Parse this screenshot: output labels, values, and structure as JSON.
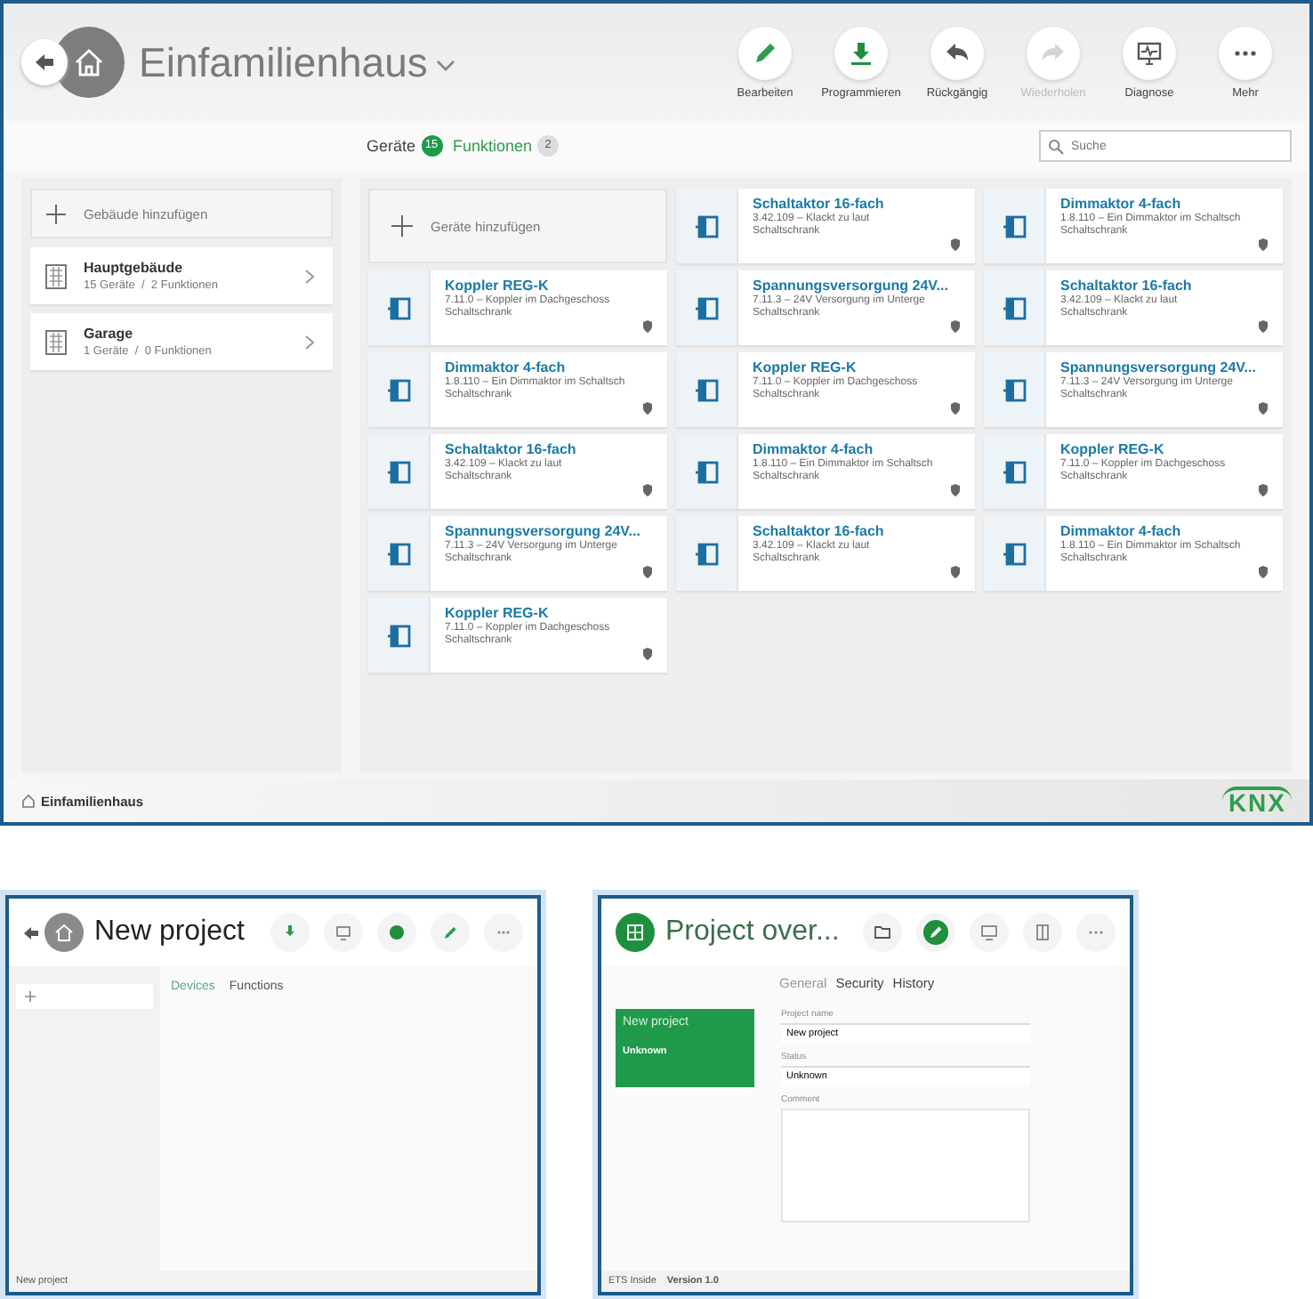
{
  "main_window": {
    "title": "Einfamilienhaus",
    "toolbar": [
      {
        "label": "Bearbeiten",
        "kind": "edit",
        "disabled": false
      },
      {
        "label": "Programmieren",
        "kind": "program",
        "disabled": false
      },
      {
        "label": "Rückgängig",
        "kind": "undo",
        "disabled": false
      },
      {
        "label": "Wiederholen",
        "kind": "redo",
        "disabled": true
      },
      {
        "label": "Diagnose",
        "kind": "diagnose",
        "disabled": false
      },
      {
        "label": "Mehr",
        "kind": "more",
        "disabled": false
      }
    ],
    "tabs": [
      {
        "label": "Geräte",
        "count": "15",
        "selected": true
      },
      {
        "label": "Funktionen",
        "count": "2",
        "selected": false
      }
    ],
    "search": {
      "placeholder": "Suche"
    },
    "sidebar": {
      "add_label": "Gebäude hinzufügen",
      "items": [
        {
          "name": "Hauptgebäude",
          "details": "15 Geräte  /  2 Funktionen"
        },
        {
          "name": "Garage",
          "details": "1 Geräte  /  0 Funktionen"
        }
      ]
    },
    "devices": {
      "add_label": "Geräte hinzufügen",
      "items": [
        {
          "name": "Schaltaktor 16-fach",
          "address": "3.42.109 – Klackt zu laut",
          "location": "Schaltschrank"
        },
        {
          "name": "Dimmaktor 4-fach",
          "address": "1.8.110 – Ein Dimmaktor im Schaltsch",
          "location": "Schaltschrank"
        },
        {
          "name": "Koppler REG-K",
          "address": "7.11.0 – Koppler im Dachgeschoss",
          "location": "Schaltschrank"
        },
        {
          "name": "Spannungsversorgung 24V...",
          "address": "7.11.3 – 24V Versorgung im Unterge",
          "location": "Schaltschrank"
        },
        {
          "name": "Schaltaktor 16-fach",
          "address": "3.42.109 – Klackt zu laut",
          "location": "Schaltschrank"
        },
        {
          "name": "Dimmaktor 4-fach",
          "address": "1.8.110 – Ein Dimmaktor im Schaltsch",
          "location": "Schaltschrank"
        },
        {
          "name": "Koppler REG-K",
          "address": "7.11.0 – Koppler im Dachgeschoss",
          "location": "Schaltschrank"
        },
        {
          "name": "Spannungsversorgung 24V...",
          "address": "7.11.3 – 24V Versorgung im Unterge",
          "location": "Schaltschrank"
        },
        {
          "name": "Schaltaktor 16-fach",
          "address": "3.42.109 – Klackt zu laut",
          "location": "Schaltschrank"
        },
        {
          "name": "Dimmaktor 4-fach",
          "address": "1.8.110 – Ein Dimmaktor im Schaltsch",
          "location": "Schaltschrank"
        },
        {
          "name": "Koppler REG-K",
          "address": "7.11.0 – Koppler im Dachgeschoss",
          "location": "Schaltschrank"
        },
        {
          "name": "Spannungsversorgung 24V...",
          "address": "7.11.3 – 24V Versorgung im Unterge",
          "location": "Schaltschrank"
        },
        {
          "name": "Schaltaktor 16-fach",
          "address": "3.42.109 – Klackt zu laut",
          "location": "Schaltschrank"
        },
        {
          "name": "Dimmaktor 4-fach",
          "address": "1.8.110 – Ein Dimmaktor im Schaltsch",
          "location": "Schaltschrank"
        },
        {
          "name": "Koppler REG-K",
          "address": "7.11.0 – Koppler im Dachgeschoss",
          "location": "Schaltschrank"
        }
      ]
    },
    "status_bar": {
      "project": "Einfamilienhaus",
      "logo": "KNX"
    }
  },
  "new_project_screen": {
    "title": "New project",
    "toolbar": [
      {
        "kind": "program"
      },
      {
        "kind": "diagnose"
      },
      {
        "kind": "check"
      },
      {
        "kind": "edit"
      },
      {
        "kind": "more"
      }
    ],
    "tabs": [
      {
        "label": "Devices",
        "selected": true
      },
      {
        "label": "Functions",
        "selected": false
      }
    ],
    "status_bar": {
      "project": "New project"
    }
  },
  "overview_screen": {
    "title": "Project over...",
    "toolbar": [
      {
        "kind": "folder"
      },
      {
        "kind": "edit_active"
      },
      {
        "kind": "diagnose"
      },
      {
        "kind": "device"
      },
      {
        "kind": "more"
      }
    ],
    "tabs": [
      {
        "label": "General",
        "selected": true
      },
      {
        "label": "Security",
        "selected": false
      },
      {
        "label": "History",
        "selected": false
      }
    ],
    "card": {
      "title": "New project",
      "status": "Unknown"
    },
    "form": [
      {
        "label": "Project name",
        "value": "New project",
        "kind": "input"
      },
      {
        "label": "Status",
        "value": "Unknown",
        "kind": "select"
      },
      {
        "label": "Comment",
        "kind": "textarea"
      }
    ],
    "status_bar": {
      "product": "ETS Inside",
      "version": "Version 1.0"
    }
  }
}
